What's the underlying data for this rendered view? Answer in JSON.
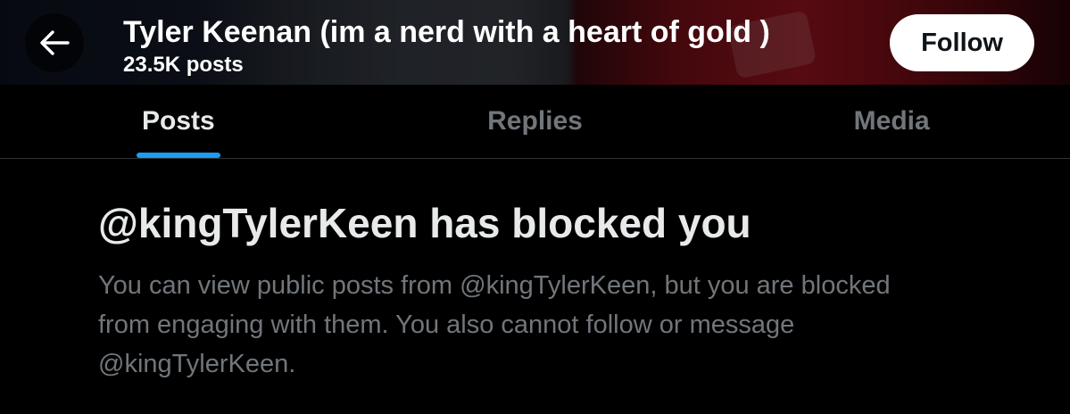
{
  "header": {
    "back_icon": "arrow-left-icon",
    "profile_name": "Tyler Keenan (im a nerd with a heart of gold )",
    "post_count": "23.5K posts",
    "follow_label": "Follow"
  },
  "tabs": [
    {
      "label": "Posts",
      "active": true
    },
    {
      "label": "Replies",
      "active": false
    },
    {
      "label": "Media",
      "active": false
    }
  ],
  "notice": {
    "title": "@kingTylerKeen has blocked you",
    "body": "You can view public posts from @kingTylerKeen, but you are blocked from engaging with them. You also cannot follow or message @kingTylerKeen."
  },
  "colors": {
    "background": "#000000",
    "primary_text": "#e7e9ea",
    "secondary_text": "#71767b",
    "accent": "#1d9bf0",
    "divider": "#2f3336"
  }
}
